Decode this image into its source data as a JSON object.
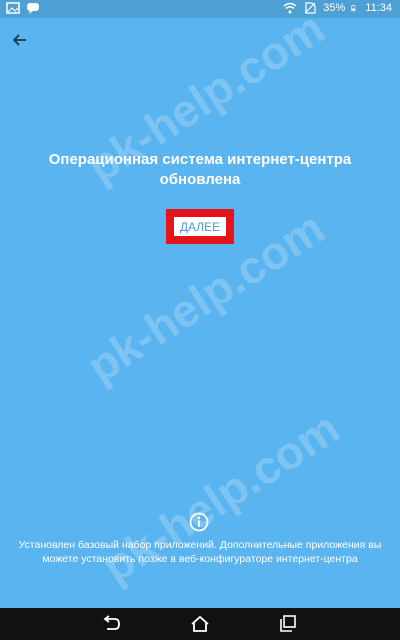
{
  "status_bar": {
    "battery": "35%",
    "time": "11:34"
  },
  "main": {
    "title": "Операционная система интернет-центра обновлена",
    "next_button": "ДАЛЕЕ",
    "info_text": "Установлен базовый набор приложений. Дополнительные приложения вы можете установить позже в веб-конфигураторе интернет-центра"
  },
  "watermark": {
    "text": "pk-help.com"
  },
  "colors": {
    "background": "#5ab4f0",
    "highlight": "#e3151b",
    "nav_bar": "#111111"
  }
}
